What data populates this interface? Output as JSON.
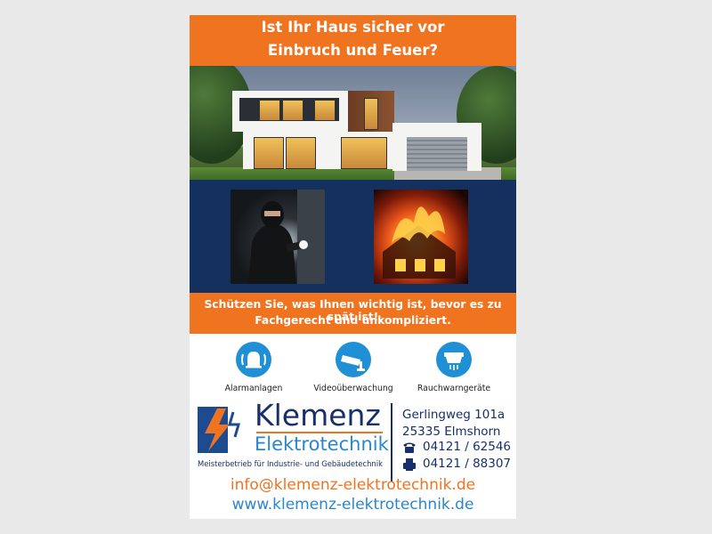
{
  "headline": {
    "line1": "Ist Ihr Haus sicher vor",
    "line2": "Einbruch und Feuer?"
  },
  "images": {
    "house": "modern-house-photo",
    "burglar": "burglar-photo",
    "fire": "burning-house-photo"
  },
  "slogan": {
    "line1": "Schützen Sie, was Ihnen wichtig ist, bevor es zu spät ist!",
    "line2": "Fachgerecht und unkompliziert."
  },
  "services": [
    {
      "label": "Alarmanlagen",
      "icon": "alarm-bell-icon"
    },
    {
      "label": "Videoüberwachung",
      "icon": "security-camera-icon"
    },
    {
      "label": "Rauchwarngeräte",
      "icon": "smoke-detector-icon"
    }
  ],
  "company": {
    "name1": "Klemenz",
    "name2": "Elektrotechnik",
    "tagline": "Meisterbetrieb für Industrie- und Gebäudetechnik",
    "street": "Gerlingweg 101a",
    "city": "25335  Elmshorn",
    "phone": "04121 / 62546",
    "fax": "04121 / 88307",
    "email": "info@klemenz-elektrotechnik.de",
    "website": "www.klemenz-elektrotechnik.de"
  },
  "colors": {
    "orange": "#f07320",
    "navy": "#13305e",
    "blue": "#1f8fd6",
    "brand_dark": "#17306a"
  }
}
